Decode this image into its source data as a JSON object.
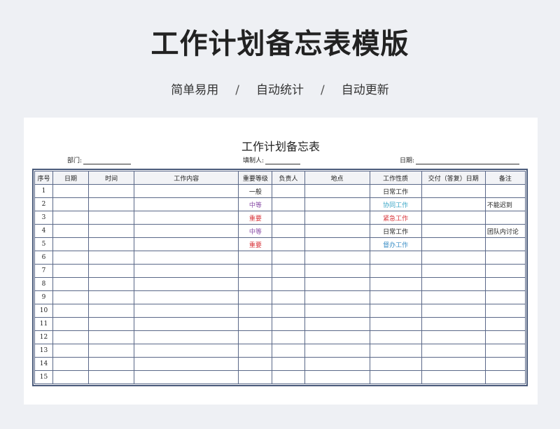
{
  "header": {
    "title": "工作计划备忘表模版",
    "features": [
      "简单易用",
      "自动统计",
      "自动更新"
    ],
    "separator": "/"
  },
  "document": {
    "title": "工作计划备忘表",
    "department_label": "部门:",
    "filler_label": "填制人:",
    "date_label": "日期:",
    "columns": [
      "序号",
      "日期",
      "时间",
      "工作内容",
      "重要等级",
      "负责人",
      "地点",
      "工作性质",
      "交付（答复）日期",
      "备注"
    ],
    "rows": [
      {
        "no": "1",
        "level": "一般",
        "nature": "日常工作",
        "note": ""
      },
      {
        "no": "2",
        "level": "中等",
        "nature": "协同工作",
        "note": "不能迟到"
      },
      {
        "no": "3",
        "level": "重要",
        "nature": "紧急工作",
        "note": ""
      },
      {
        "no": "4",
        "level": "中等",
        "nature": "日常工作",
        "note": "团队内讨论"
      },
      {
        "no": "5",
        "level": "重要",
        "nature": "督办工作",
        "note": ""
      },
      {
        "no": "6",
        "level": "",
        "nature": "",
        "note": ""
      },
      {
        "no": "7",
        "level": "",
        "nature": "",
        "note": ""
      },
      {
        "no": "8",
        "level": "",
        "nature": "",
        "note": ""
      },
      {
        "no": "9",
        "level": "",
        "nature": "",
        "note": ""
      },
      {
        "no": "10",
        "level": "",
        "nature": "",
        "note": ""
      },
      {
        "no": "11",
        "level": "",
        "nature": "",
        "note": ""
      },
      {
        "no": "12",
        "level": "",
        "nature": "",
        "note": ""
      },
      {
        "no": "13",
        "level": "",
        "nature": "",
        "note": ""
      },
      {
        "no": "14",
        "level": "",
        "nature": "",
        "note": ""
      },
      {
        "no": "15",
        "level": "",
        "nature": "",
        "note": ""
      }
    ]
  },
  "colors": {
    "level": {
      "一般": "#222222",
      "中等": "#8a4fa8",
      "重要": "#d8343a"
    },
    "nature": {
      "日常工作": "#222222",
      "协同工作": "#3aa6c6",
      "紧急工作": "#d8343a",
      "督办工作": "#3a8ec6"
    }
  }
}
